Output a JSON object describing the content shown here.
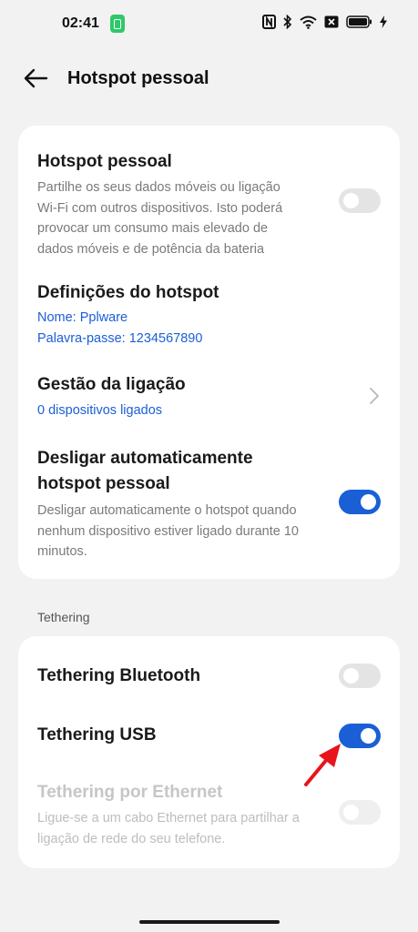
{
  "status_bar": {
    "time": "02:41"
  },
  "header": {
    "title": "Hotspot pessoal"
  },
  "hotspot": {
    "title": "Hotspot pessoal",
    "desc_line1": "Partilhe os seus dados móveis ou ligação",
    "desc_line2": "Wi-Fi com outros dispositivos. Isto poderá",
    "desc_line3": "provocar um consumo mais elevado de",
    "desc_line4": "dados móveis e de potência da bateria",
    "enabled": false
  },
  "settings": {
    "title": "Definições do hotspot",
    "name": "Nome: Pplware",
    "password": "Palavra-passe: 1234567890"
  },
  "connection": {
    "title": "Gestão da ligação",
    "devices": "0 dispositivos ligados"
  },
  "auto_off": {
    "title_line1": "Desligar automaticamente",
    "title_line2": "hotspot pessoal",
    "desc_line1": "Desligar automaticamente o hotspot quando",
    "desc_line2": "nenhum dispositivo estiver ligado durante 10",
    "desc_line3": "minutos.",
    "enabled": true
  },
  "tethering": {
    "section_label": "Tethering",
    "bluetooth": {
      "title": "Tethering Bluetooth",
      "enabled": false
    },
    "usb": {
      "title": "Tethering USB",
      "enabled": true
    },
    "ethernet": {
      "title": "Tethering por Ethernet",
      "desc_line1": "Ligue-se a um cabo Ethernet para partilhar a",
      "desc_line2": "ligação de rede do seu telefone.",
      "enabled": false
    }
  },
  "colors": {
    "accent": "#1a5fd6",
    "background": "#f2f2f2",
    "card": "#ffffff",
    "annotation_arrow": "#e8141c"
  }
}
